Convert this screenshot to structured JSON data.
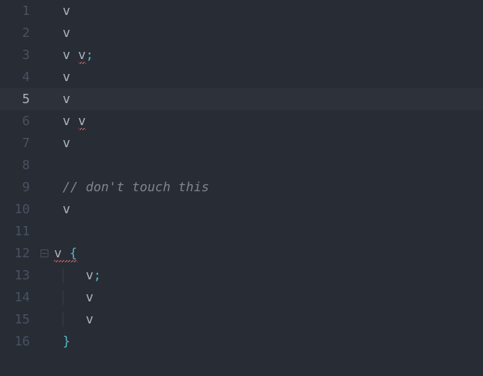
{
  "editor": {
    "current_line": 5,
    "fold_line": 12,
    "lines": [
      {
        "num": "1",
        "tokens": [
          {
            "t": "v",
            "cls": "tok"
          }
        ],
        "indent_guide": false
      },
      {
        "num": "2",
        "tokens": [
          {
            "t": "v",
            "cls": "tok"
          }
        ],
        "indent_guide": false
      },
      {
        "num": "3",
        "tokens": [
          {
            "t": "v",
            "cls": "tok"
          },
          {
            "t": " ",
            "cls": "tok"
          },
          {
            "t": "v",
            "cls": "tok squiggle"
          },
          {
            "t": ";",
            "cls": "punct"
          }
        ],
        "indent_guide": false
      },
      {
        "num": "4",
        "tokens": [
          {
            "t": "v",
            "cls": "tok"
          }
        ],
        "indent_guide": false
      },
      {
        "num": "5",
        "tokens": [
          {
            "t": "v",
            "cls": "tok"
          }
        ],
        "indent_guide": false
      },
      {
        "num": "6",
        "tokens": [
          {
            "t": "v",
            "cls": "tok"
          },
          {
            "t": " ",
            "cls": "tok"
          },
          {
            "t": "v",
            "cls": "tok squiggle"
          }
        ],
        "indent_guide": false
      },
      {
        "num": "7",
        "tokens": [
          {
            "t": "v",
            "cls": "tok"
          }
        ],
        "indent_guide": false
      },
      {
        "num": "8",
        "tokens": [],
        "indent_guide": false
      },
      {
        "num": "9",
        "tokens": [
          {
            "t": "// don't touch this",
            "cls": "comment"
          }
        ],
        "indent_guide": false
      },
      {
        "num": "10",
        "tokens": [
          {
            "t": "v",
            "cls": "tok"
          }
        ],
        "indent_guide": false
      },
      {
        "num": "11",
        "tokens": [],
        "indent_guide": false
      },
      {
        "num": "12",
        "tokens": [
          {
            "t": "v",
            "cls": "tok"
          },
          {
            "t": " ",
            "cls": "tok"
          },
          {
            "t": "{",
            "cls": "brace squiggle"
          }
        ],
        "indent_guide": false,
        "no_pad": true
      },
      {
        "num": "13",
        "tokens": [
          {
            "t": "   ",
            "cls": "tok"
          },
          {
            "t": "v",
            "cls": "tok"
          },
          {
            "t": ";",
            "cls": "punct"
          }
        ],
        "indent_guide": true
      },
      {
        "num": "14",
        "tokens": [
          {
            "t": "   ",
            "cls": "tok"
          },
          {
            "t": "v",
            "cls": "tok"
          }
        ],
        "indent_guide": true
      },
      {
        "num": "15",
        "tokens": [
          {
            "t": "   ",
            "cls": "tok"
          },
          {
            "t": "v",
            "cls": "tok"
          }
        ],
        "indent_guide": true
      },
      {
        "num": "16",
        "tokens": [
          {
            "t": "}",
            "cls": "brace"
          }
        ],
        "indent_guide": false
      }
    ]
  }
}
